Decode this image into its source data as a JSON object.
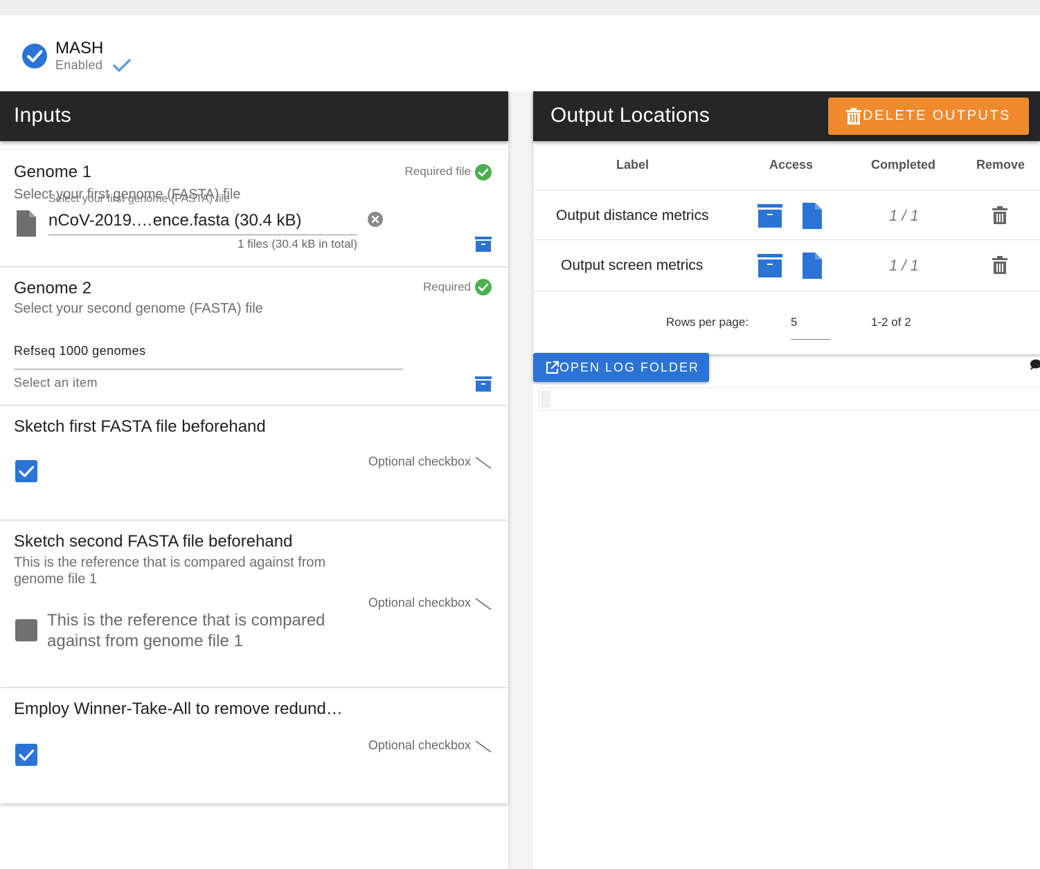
{
  "header": {
    "title": "MASH",
    "status": "Enabled"
  },
  "inputs": {
    "title": "Inputs",
    "genome1": {
      "title": "Genome 1",
      "description": "Select your first genome (FASTA) file",
      "requirement": "Required file",
      "field_label": "Select your first genome (FASTA) file",
      "file_name": "nCoV-2019.…ence.fasta (30.4 kB)",
      "files_summary": "1 files (30.4 kB in total)"
    },
    "genome2": {
      "title": "Genome 2",
      "description": "Select your second genome (FASTA) file",
      "requirement": "Required",
      "selected_value": "Refseq 1000 genomes",
      "hint": "Select an item"
    },
    "sketch1": {
      "title": "Sketch first FASTA file beforehand",
      "requirement": "Optional checkbox",
      "checked": true
    },
    "sketch2": {
      "title": "Sketch second FASTA file beforehand",
      "description": "This is the reference that is compared against from genome file 1",
      "requirement": "Optional checkbox",
      "checkbox_label": "This is the reference that is compared against from genome file 1",
      "checked": false
    },
    "wta": {
      "title": "Employ Winner-Take-All to remove redund…",
      "requirement": "Optional checkbox",
      "checked": true
    }
  },
  "outputs": {
    "title": "Output Locations",
    "delete_label": "DELETE OUTPUTS",
    "columns": {
      "label": "Label",
      "access": "Access",
      "completed": "Completed",
      "remove": "Remove"
    },
    "rows": [
      {
        "label": "Output distance metrics",
        "completed": "1 / 1"
      },
      {
        "label": "Output screen metrics",
        "completed": "1 / 1"
      }
    ],
    "pagination": {
      "rows_per_page_label": "Rows per page:",
      "rows_per_page": "5",
      "range": "1-2 of 2"
    },
    "open_log_label": "OPEN LOG FOLDER"
  },
  "colors": {
    "accent_blue": "#2b73d5",
    "orange": "#f08a2f",
    "success_green": "#4caf50",
    "dark_header": "#262626"
  }
}
